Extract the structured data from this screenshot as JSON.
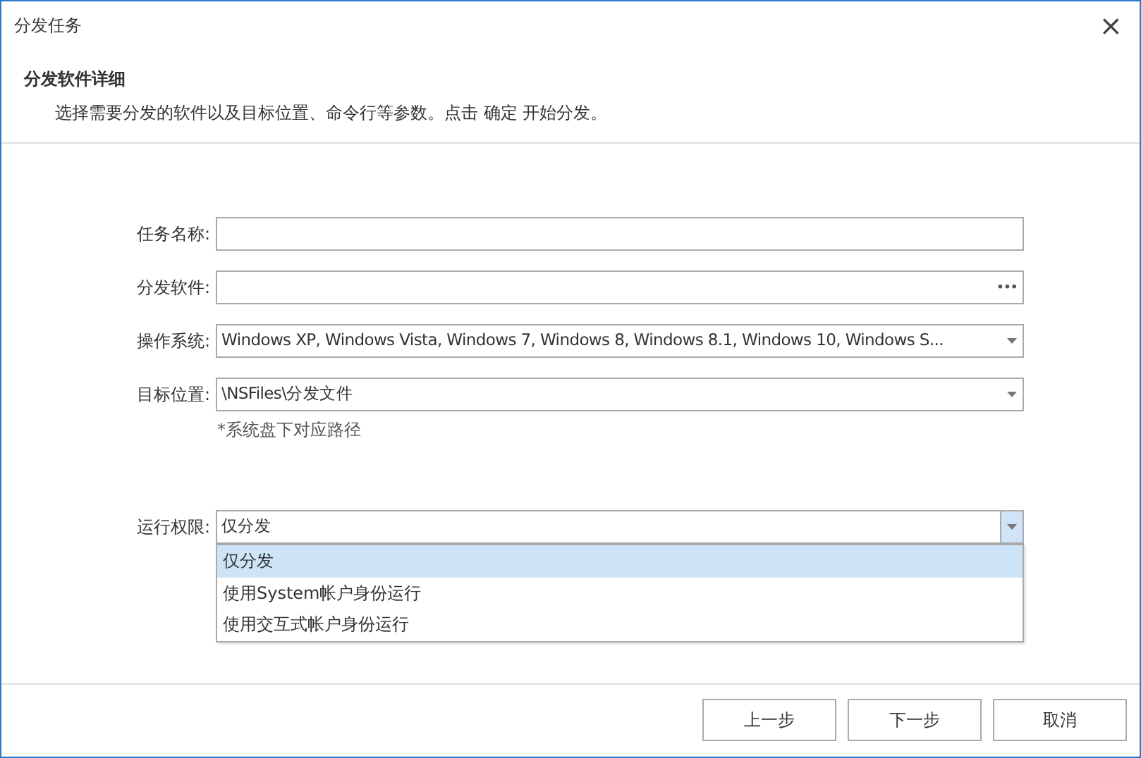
{
  "window": {
    "title": "分发任务",
    "close": "×"
  },
  "header": {
    "title": "分发软件详细",
    "subtitle": "选择需要分发的软件以及目标位置、命令行等参数。点击 确定 开始分发。"
  },
  "fields": [
    {
      "label": "任务名称:",
      "kind": "text"
    },
    {
      "label": "分发软件:",
      "kind": "browse",
      "button": "•••"
    },
    {
      "label": "操作系统:",
      "kind": "select",
      "value": "Windows XP, Windows Vista, Windows 7, Windows 8, Windows 8.1, Windows 10, Windows S..."
    },
    {
      "label": "目标位置:",
      "kind": "select",
      "value": "\\NSFiles\\分发文件",
      "hint": "*系统盘下对应路径"
    }
  ],
  "run_permission": {
    "label": "运行权限:",
    "value": "仅分发",
    "expanded": true,
    "options": [
      {
        "label": "仅分发",
        "selected": true
      },
      {
        "label": "使用System帐户身份运行",
        "selected": false
      },
      {
        "label": "使用交互式帐户身份运行",
        "selected": false
      }
    ]
  },
  "buttons": [
    "上一步",
    "下一步",
    "取消"
  ]
}
